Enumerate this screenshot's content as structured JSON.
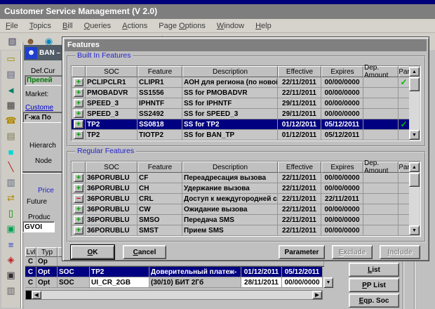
{
  "window": {
    "title": "Customer Service Management  (V 2.0)"
  },
  "menu": {
    "items": [
      {
        "label": "File",
        "m": 0
      },
      {
        "label": "Topics",
        "m": 0
      },
      {
        "label": "Bill",
        "m": 0
      },
      {
        "label": "Queries",
        "m": 0
      },
      {
        "label": "Actions",
        "m": 0
      },
      {
        "label": "Page Options",
        "m": 5
      },
      {
        "label": "Window",
        "m": 0
      },
      {
        "label": "Help",
        "m": 0
      }
    ]
  },
  "dialog": {
    "title": "Features",
    "built_in_label": "Built In Features",
    "regular_label": "Regular Features",
    "columns": {
      "soc": "SOC",
      "feature": "Feature",
      "description": "Description",
      "effective": "Effective",
      "expires": "Expires",
      "dep_amount": "Dep. Amount",
      "par": "Par"
    },
    "built_in_rows": [
      {
        "action": "add",
        "soc": "PCLIPCLR1",
        "feature": "CLIPR1",
        "description": "АОН для региона (по новой",
        "effective": "22/11/2011",
        "expires": "00/00/0000",
        "dep_amount": "",
        "par": "✓",
        "selected": false
      },
      {
        "action": "add",
        "soc": "PMOBADVR",
        "feature": "SS1556",
        "description": "SS for PMOBADVR",
        "effective": "22/11/2011",
        "expires": "00/00/0000",
        "dep_amount": "",
        "par": "",
        "selected": false
      },
      {
        "action": "add",
        "soc": "SPEED_3",
        "feature": "IPHNTF",
        "description": "SS for IPHNTF",
        "effective": "29/11/2011",
        "expires": "00/00/0000",
        "dep_amount": "",
        "par": "",
        "selected": false
      },
      {
        "action": "add",
        "soc": "SPEED_3",
        "feature": "SS2492",
        "description": "SS for SPEED_3",
        "effective": "29/11/2011",
        "expires": "00/00/0000",
        "dep_amount": "",
        "par": "",
        "selected": false
      },
      {
        "action": "add",
        "soc": "TP2",
        "feature": "SS0818",
        "description": "SS for TP2",
        "effective": "01/12/2011",
        "expires": "05/12/2011",
        "dep_amount": "",
        "par": "✓",
        "selected": true
      },
      {
        "action": "add",
        "soc": "TP2",
        "feature": "TIOTP2",
        "description": "SS for BAN_TP",
        "effective": "01/12/2011",
        "expires": "05/12/2011",
        "dep_amount": "",
        "par": "",
        "selected": false
      }
    ],
    "regular_rows": [
      {
        "action": "add",
        "soc": "36PORUBLU",
        "feature": "CF",
        "description": "Переадресация вызова",
        "effective": "22/11/2011",
        "expires": "00/00/0000",
        "dep_amount": "",
        "par": "",
        "selected": false
      },
      {
        "action": "add",
        "soc": "36PORUBLU",
        "feature": "CH",
        "description": "Удержание вызова",
        "effective": "22/11/2011",
        "expires": "00/00/0000",
        "dep_amount": "",
        "par": "",
        "selected": false
      },
      {
        "action": "remove",
        "soc": "36PORUBLU",
        "feature": "CRL",
        "description": "Доступ к междугородней с",
        "effective": "22/11/2011",
        "expires": "22/11/2011",
        "dep_amount": "",
        "par": "",
        "selected": false
      },
      {
        "action": "add",
        "soc": "36PORUBLU",
        "feature": "CW",
        "description": "Ожидание вызова",
        "effective": "22/11/2011",
        "expires": "00/00/0000",
        "dep_amount": "",
        "par": "",
        "selected": false
      },
      {
        "action": "add",
        "soc": "36PORUBLU",
        "feature": "SMSO",
        "description": "Передача SMS",
        "effective": "22/11/2011",
        "expires": "00/00/0000",
        "dep_amount": "",
        "par": "",
        "selected": false
      },
      {
        "action": "add",
        "soc": "36PORUBLU",
        "feature": "SMST",
        "description": "Прием SMS",
        "effective": "22/11/2011",
        "expires": "00/00/0000",
        "dep_amount": "",
        "par": "",
        "selected": false
      }
    ],
    "buttons": {
      "ok": {
        "label": "OK",
        "m": 0
      },
      "cancel": {
        "label": "Cancel",
        "m": 0
      },
      "parameter": {
        "label": "Parameter",
        "m": -1
      },
      "exclude": {
        "label": "Exclude",
        "m": 0,
        "disabled": true
      },
      "include": {
        "label": "Include",
        "m": 0,
        "disabled": true
      }
    }
  },
  "background": {
    "ban_title": "BAN –",
    "def_cur": "Def.Cur",
    "prepaid": "Препей",
    "market": "Market:",
    "customer_link": "Custome",
    "customer_value": "Г-жа По",
    "hierarchy": "Hierarch",
    "node": "Node",
    "price_label": "Price",
    "future": "Future",
    "product": "Produc",
    "product_value": "GVOI",
    "table": {
      "header": {
        "lvl": "Lvl",
        "typ": "Typ"
      },
      "partial_row": {
        "lvl": "C",
        "typ": "Op"
      },
      "rows": [
        {
          "lvl": "C",
          "typ": "Opt",
          "kind": "SOC",
          "code": "TP2",
          "description": "Доверительный платеж-",
          "effective": "01/12/2011",
          "expires": "05/12/2011",
          "selected": true
        },
        {
          "lvl": "C",
          "typ": "Opt",
          "kind": "SOC",
          "code": "UI_CR_2GB",
          "description": "(30/10) БИТ 2Гб",
          "effective": "28/11/2011",
          "expires": "00/00/0000",
          "selected": false
        }
      ]
    },
    "side_buttons": [
      {
        "label": "List",
        "m": 0
      },
      {
        "label": "PP List",
        "m": 0
      },
      {
        "label": "Eqp. Soc",
        "m": 0
      }
    ]
  },
  "icons": {
    "top_toolbar": [
      {
        "name": "form-icon",
        "glyph": "▧",
        "color": "#404060"
      },
      {
        "name": "user-icon",
        "glyph": "☻",
        "color": "#7a5030"
      },
      {
        "name": "refresh-icon",
        "glyph": "◉",
        "color": "#0088bb"
      }
    ],
    "top_partials": [
      {
        "name": "toolbar-partial-icon",
        "glyph": "▪",
        "color": "#204020"
      },
      {
        "name": "toolbar-partial-icon",
        "glyph": "▪",
        "color": "#402020"
      },
      {
        "name": "toolbar-partial-icon",
        "glyph": "▪",
        "color": "#203050"
      },
      {
        "name": "toolbar-partial-icon",
        "glyph": "▪",
        "color": "#404020"
      },
      {
        "name": "toolbar-partial-icon",
        "glyph": "▪",
        "color": "#302040"
      },
      {
        "name": "toolbar-partial-icon",
        "glyph": "▪",
        "color": "#555555"
      },
      {
        "name": "toolbar-partial-icon",
        "glyph": "▪",
        "color": "#204060"
      }
    ],
    "left_toolbar": [
      {
        "name": "open-folder-icon",
        "glyph": "▭",
        "color": "#9a8f00"
      },
      {
        "name": "print-icon",
        "glyph": "▤",
        "color": "#5a5a7a"
      },
      {
        "name": "back-icon",
        "glyph": "◄",
        "color": "#008060"
      },
      {
        "name": "calculator-icon",
        "glyph": "▦",
        "color": "#404040"
      },
      {
        "name": "phone-icon",
        "glyph": "☎",
        "color": "#b08800"
      },
      {
        "name": "script-icon",
        "glyph": "▤",
        "color": "#7a7a52"
      },
      {
        "name": "swatch-icon",
        "glyph": "■",
        "color": "#00d8d8"
      },
      {
        "name": "screwdriver-icon",
        "glyph": "╲",
        "color": "#b02020"
      },
      {
        "name": "id-card-icon",
        "glyph": "▥",
        "color": "#5a6a7a"
      },
      {
        "name": "transfer-arrows-icon",
        "glyph": "⇄",
        "color": "#b08800"
      },
      {
        "name": "document-icon",
        "glyph": "▯",
        "color": "#009000"
      },
      {
        "name": "copy-documents-icon",
        "glyph": "▣",
        "color": "#00a050"
      },
      {
        "name": "stack-icon",
        "glyph": "≡",
        "color": "#3040c0"
      },
      {
        "name": "cart-icon",
        "glyph": "◈",
        "color": "#c02020"
      },
      {
        "name": "save-icon",
        "glyph": "▣",
        "color": "#303030"
      },
      {
        "name": "devices-icon",
        "glyph": "▥",
        "color": "#606060"
      }
    ]
  },
  "colors": {
    "selection": "#000080",
    "check_green": "#00bb00",
    "group_label": "#2222cc",
    "link": "#0000cc",
    "prepaid_green": "#007800",
    "titlebar": "#7e7e7e"
  }
}
